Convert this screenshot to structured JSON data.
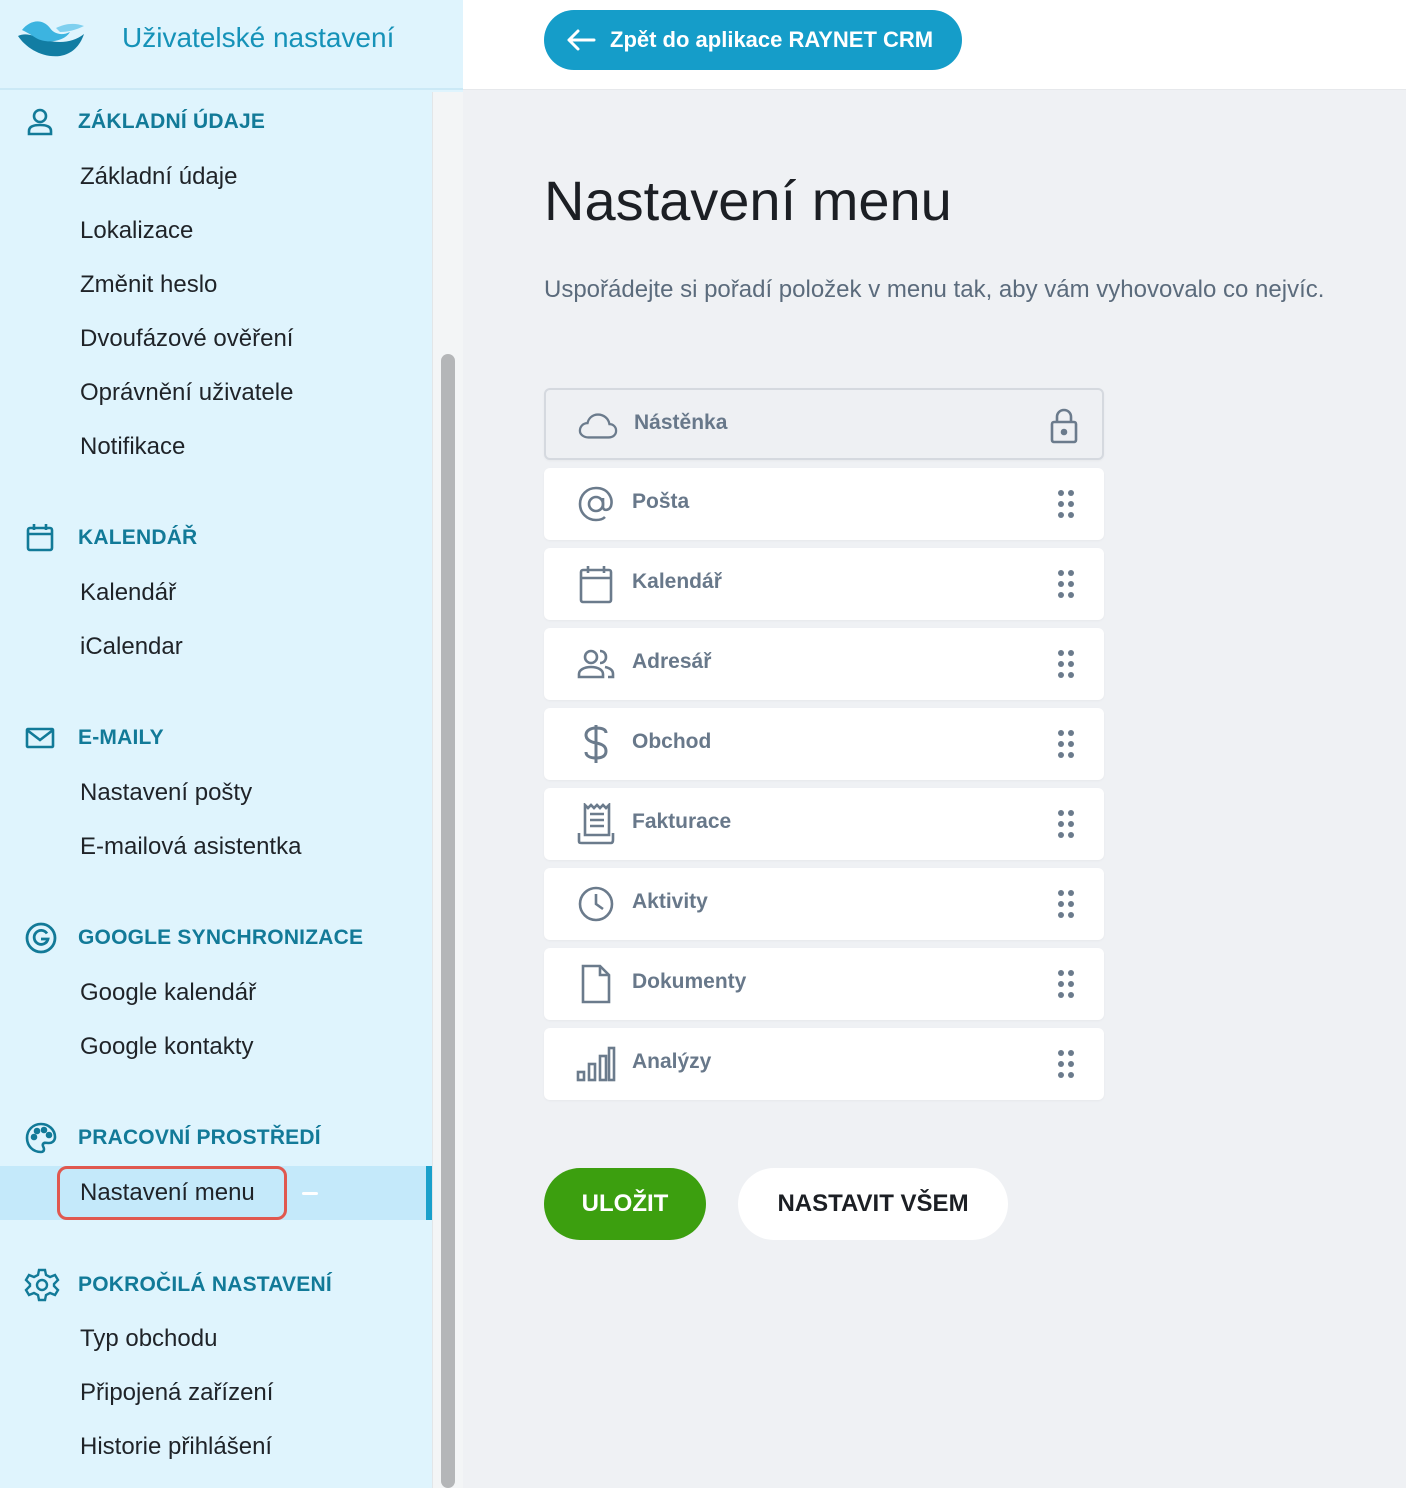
{
  "sidebar": {
    "title": "Uživatelské nastavení",
    "sections": [
      {
        "title": "ZÁKLADNÍ ÚDAJE",
        "icon": "user-icon",
        "items": [
          "Základní údaje",
          "Lokalizace",
          "Změnit heslo",
          "Dvoufázové ověření",
          "Oprávnění uživatele",
          "Notifikace"
        ]
      },
      {
        "title": "KALENDÁŘ",
        "icon": "calendar-icon",
        "items": [
          "Kalendář",
          "iCalendar"
        ]
      },
      {
        "title": "E-MAILY",
        "icon": "mail-icon",
        "items": [
          "Nastavení pošty",
          "E-mailová asistentka"
        ]
      },
      {
        "title": "GOOGLE SYNCHRONIZACE",
        "icon": "google-icon",
        "items": [
          "Google kalendář",
          "Google kontakty"
        ]
      },
      {
        "title": "PRACOVNÍ PROSTŘEDÍ",
        "icon": "palette-icon",
        "items": [
          "Nastavení menu"
        ]
      },
      {
        "title": "POKROČILÁ NASTAVENÍ",
        "icon": "gear-icon",
        "items": [
          "Typ obchodu",
          "Připojená zařízení",
          "Historie přihlášení"
        ]
      }
    ],
    "active_item": "Nastavení menu"
  },
  "topbar": {
    "back_label": "Zpět do aplikace RAYNET CRM"
  },
  "main": {
    "title": "Nastavení menu",
    "description": "Uspořádejte si pořadí položek v menu tak, aby vám vyhovovalo co nejvíc.",
    "menu_items": [
      {
        "label": "Nástěnka",
        "icon": "cloud-icon",
        "locked": true
      },
      {
        "label": "Pošta",
        "icon": "at-icon",
        "locked": false
      },
      {
        "label": "Kalendář",
        "icon": "calendar-icon",
        "locked": false
      },
      {
        "label": "Adresář",
        "icon": "contacts-icon",
        "locked": false
      },
      {
        "label": "Obchod",
        "icon": "dollar-icon",
        "locked": false
      },
      {
        "label": "Fakturace",
        "icon": "invoice-icon",
        "locked": false
      },
      {
        "label": "Aktivity",
        "icon": "clock-icon",
        "locked": false
      },
      {
        "label": "Dokumenty",
        "icon": "document-icon",
        "locked": false
      },
      {
        "label": "Analýzy",
        "icon": "bar-chart-icon",
        "locked": false
      }
    ],
    "save_label": "ULOŽIT",
    "set_all_label": "NASTAVIT VŠEM"
  },
  "colors": {
    "accent": "#159dc9",
    "section_title": "#127a98",
    "save": "#3c9f0f",
    "highlight": "#e0584f"
  }
}
